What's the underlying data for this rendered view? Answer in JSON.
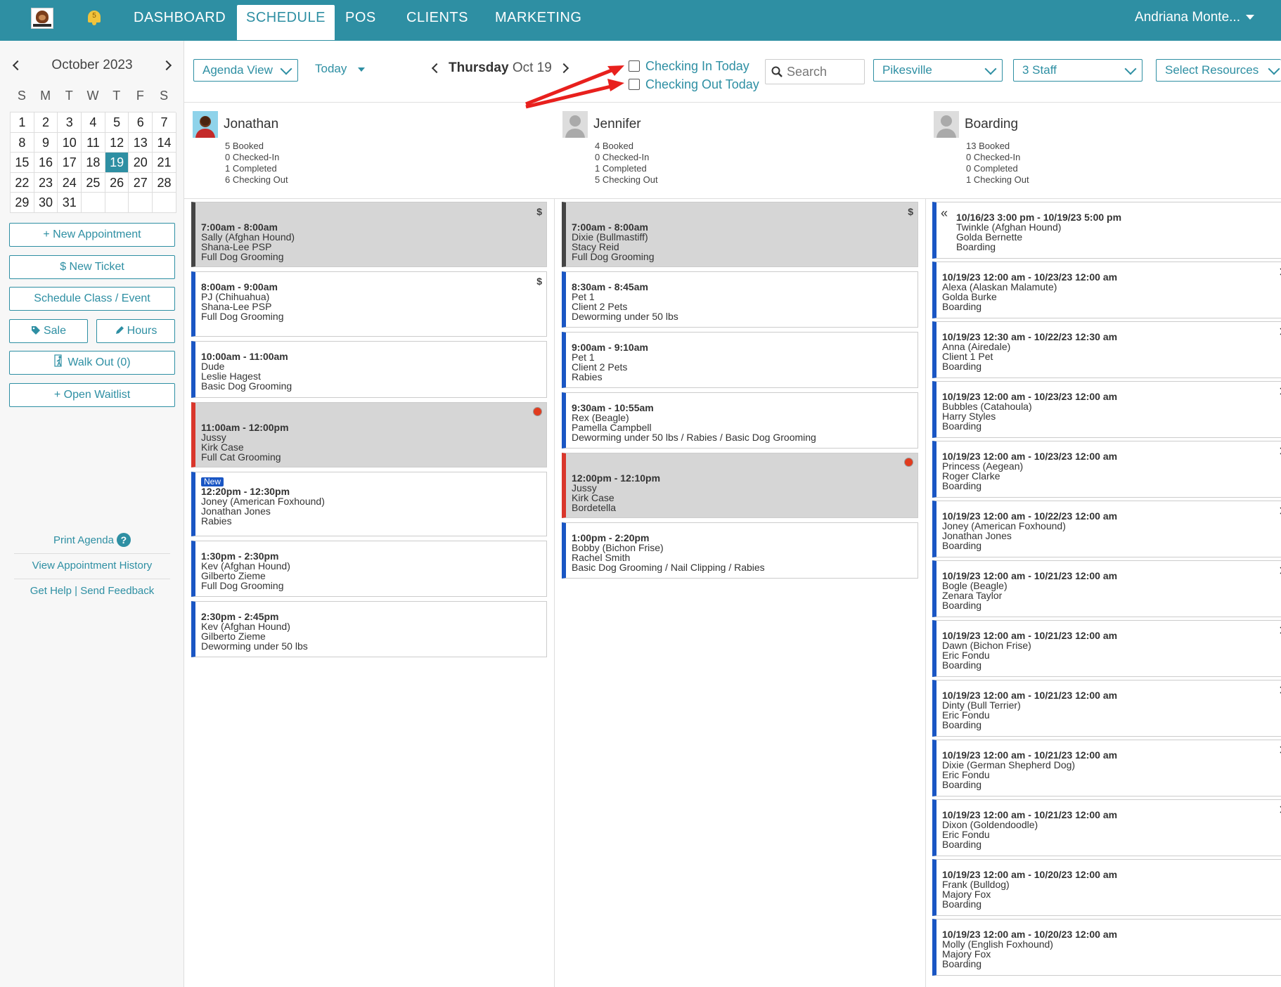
{
  "nav": {
    "notification_count": "5",
    "tabs": [
      "DASHBOARD",
      "SCHEDULE",
      "POS",
      "CLIENTS",
      "MARKETING"
    ],
    "active_tab": "SCHEDULE",
    "user": "Andriana Monte..."
  },
  "calendar": {
    "month": "October 2023",
    "dow": [
      "S",
      "M",
      "T",
      "W",
      "T",
      "F",
      "S"
    ],
    "days": [
      "1",
      "2",
      "3",
      "4",
      "5",
      "6",
      "7",
      "8",
      "9",
      "10",
      "11",
      "12",
      "13",
      "14",
      "15",
      "16",
      "17",
      "18",
      "19",
      "20",
      "21",
      "22",
      "23",
      "24",
      "25",
      "26",
      "27",
      "28",
      "29",
      "30",
      "31",
      "",
      "",
      "",
      ""
    ],
    "selected": "19"
  },
  "sidebar": {
    "new_appointment": "+ New Appointment",
    "new_ticket": "$ New Ticket",
    "schedule_class": "Schedule Class / Event",
    "sale": "Sale",
    "hours": "Hours",
    "walk_out": "Walk Out (0)",
    "open_waitlist": "+ Open Waitlist",
    "print_agenda": "Print Agenda",
    "help_icon_text": "?",
    "view_history": "View Appointment History",
    "get_help": "Get Help",
    "separator": "|",
    "send_feedback": "Send Feedback"
  },
  "toolbar": {
    "view": "Agenda View",
    "today": "Today",
    "day_name": "Thursday",
    "date": "Oct 19",
    "checking_in": "Checking In Today",
    "checking_out": "Checking Out Today",
    "search_placeholder": "Search",
    "location": "Pikesville",
    "staff": "3 Staff",
    "resources": "Select Resources"
  },
  "columns": [
    {
      "name": "Jonathan",
      "stats": [
        "5 Booked",
        "0 Checked-In",
        "1 Completed",
        "6 Checking Out"
      ],
      "appointments": [
        {
          "status": "gray",
          "badge": "$",
          "time": "7:00am - 8:00am",
          "lines": [
            "Sally (Afghan Hound)",
            "Shana-Lee PSP",
            "Full Dog Grooming"
          ]
        },
        {
          "status": "blue",
          "badge": "$",
          "time": "8:00am - 9:00am",
          "lines": [
            "PJ (Chihuahua)",
            "Shana-Lee PSP",
            "Full Dog Grooming"
          ]
        },
        {
          "status": "blue",
          "badge": "",
          "time": "10:00am - 11:00am",
          "lines": [
            "Dude",
            "Leslie Hagest",
            "Basic Dog Grooming"
          ]
        },
        {
          "status": "red",
          "badge": "dot",
          "time": "11:00am - 12:00pm",
          "lines": [
            "Jussy",
            "Kirk Case",
            "Full Cat Grooming"
          ]
        },
        {
          "status": "blue",
          "badge": "",
          "new_label": "New",
          "time": "12:20pm - 12:30pm",
          "lines": [
            "Joney (American Foxhound)",
            "Jonathan Jones",
            "Rabies"
          ]
        },
        {
          "status": "blue",
          "badge": "",
          "time": "1:30pm - 2:30pm",
          "lines": [
            "Kev (Afghan Hound)",
            "Gilberto Zieme",
            "Full Dog Grooming"
          ]
        },
        {
          "status": "blue",
          "badge": "",
          "time": "2:30pm - 2:45pm",
          "lines": [
            "Kev (Afghan Hound)",
            "Gilberto Zieme",
            "Deworming under 50 lbs"
          ]
        }
      ]
    },
    {
      "name": "Jennifer",
      "stats": [
        "4 Booked",
        "0 Checked-In",
        "1 Completed",
        "5 Checking Out"
      ],
      "appointments": [
        {
          "status": "gray",
          "badge": "$",
          "time": "7:00am - 8:00am",
          "lines": [
            "Dixie (Bullmastiff)",
            "Stacy Reid",
            "Full Dog Grooming"
          ]
        },
        {
          "status": "blue",
          "badge": "",
          "time": "8:30am - 8:45am",
          "lines": [
            "Pet 1",
            "Client 2 Pets",
            "Deworming under 50 lbs"
          ]
        },
        {
          "status": "blue",
          "badge": "",
          "time": "9:00am - 9:10am",
          "lines": [
            "Pet 1",
            "Client 2 Pets",
            "Rabies"
          ]
        },
        {
          "status": "blue",
          "badge": "",
          "time": "9:30am - 10:55am",
          "lines": [
            "Rex (Beagle)",
            "Pamella Campbell",
            "Deworming under 50 lbs / Rabies / Basic Dog Grooming"
          ]
        },
        {
          "status": "red",
          "badge": "dot",
          "time": "12:00pm - 12:10pm",
          "lines": [
            "Jussy",
            "Kirk Case",
            "Bordetella"
          ]
        },
        {
          "status": "blue",
          "badge": "",
          "time": "1:00pm - 2:20pm",
          "lines": [
            "Bobby (Bichon Frise)",
            "Rachel Smith",
            "Basic Dog Grooming / Nail Clipping / Rabies"
          ]
        }
      ]
    },
    {
      "name": "Boarding",
      "stats": [
        "13 Booked",
        "0 Checked-In",
        "0 Completed",
        "1 Checking Out"
      ],
      "appointments": [
        {
          "status": "blue",
          "prefix": "«",
          "time": "10/16/23 3:00 pm - 10/19/23 5:00 pm",
          "lines": [
            "Twinkle (Afghan Hound)",
            "Golda Bernette",
            "Boarding"
          ]
        },
        {
          "status": "blue",
          "time": "10/19/23 12:00 am - 10/23/23 12:00 am",
          "lines": [
            "Alexa (Alaskan Malamute)",
            "Golda Burke",
            "Boarding"
          ]
        },
        {
          "status": "blue",
          "time": "10/19/23 12:30 am - 10/22/23 12:30 am",
          "lines": [
            "Anna (Airedale)",
            "Client 1 Pet",
            "Boarding"
          ]
        },
        {
          "status": "blue",
          "time": "10/19/23 12:00 am - 10/23/23 12:00 am",
          "lines": [
            "Bubbles (Catahoula)",
            "Harry Styles",
            "Boarding"
          ]
        },
        {
          "status": "blue",
          "time": "10/19/23 12:00 am - 10/23/23 12:00 am",
          "lines": [
            "Princess (Aegean)",
            "Roger Clarke",
            "Boarding"
          ]
        },
        {
          "status": "blue",
          "time": "10/19/23 12:00 am - 10/22/23 12:00 am",
          "lines": [
            "Joney (American Foxhound)",
            "Jonathan Jones",
            "Boarding"
          ]
        },
        {
          "status": "blue",
          "time": "10/19/23 12:00 am - 10/21/23 12:00 am",
          "lines": [
            "Bogle (Beagle)",
            "Zenara Taylor",
            "Boarding"
          ]
        },
        {
          "status": "blue",
          "time": "10/19/23 12:00 am - 10/21/23 12:00 am",
          "lines": [
            "Dawn (Bichon Frise)",
            "Eric Fondu",
            "Boarding"
          ]
        },
        {
          "status": "blue",
          "time": "10/19/23 12:00 am - 10/21/23 12:00 am",
          "lines": [
            "Dinty (Bull Terrier)",
            "Eric Fondu",
            "Boarding"
          ]
        },
        {
          "status": "blue",
          "time": "10/19/23 12:00 am - 10/21/23 12:00 am",
          "lines": [
            "Dixie (German Shepherd Dog)",
            "Eric Fondu",
            "Boarding"
          ]
        },
        {
          "status": "blue",
          "time": "10/19/23 12:00 am - 10/21/23 12:00 am",
          "lines": [
            "Dixon (Goldendoodle)",
            "Eric Fondu",
            "Boarding"
          ]
        },
        {
          "status": "blue",
          "time": "10/19/23 12:00 am - 10/20/23 12:00 am",
          "lines": [
            "Frank (Bulldog)",
            "Majory Fox",
            "Boarding"
          ]
        },
        {
          "status": "blue",
          "time": "10/19/23 12:00 am - 10/20/23 12:00 am",
          "lines": [
            "Molly (English Foxhound)",
            "Majory Fox",
            "Boarding"
          ]
        }
      ]
    }
  ],
  "colors": {
    "brand": "#2e8fa3",
    "accent_blue": "#1a56c4",
    "alert_red": "#e13b1e",
    "arrow_red": "#e8201d"
  }
}
